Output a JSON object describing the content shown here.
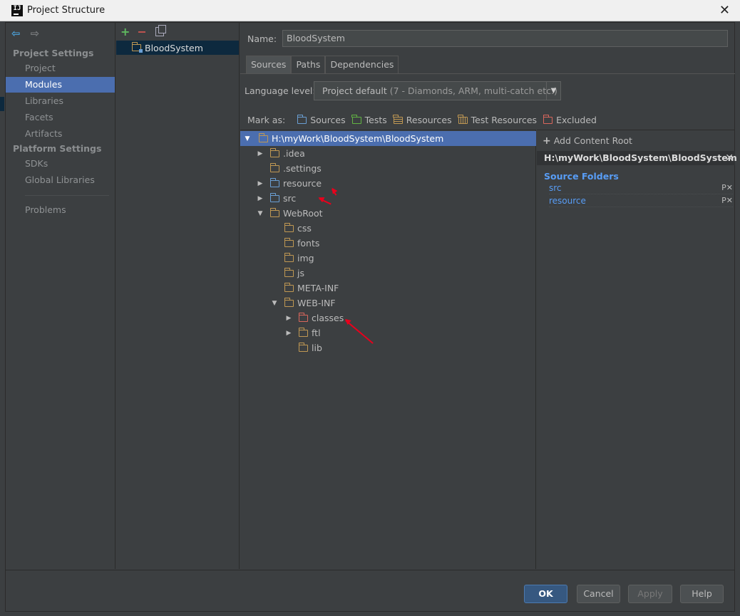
{
  "window": {
    "title": "Project Structure",
    "close_glyph": "✕",
    "app_icon": "IJ"
  },
  "nav": {
    "back_icon": "arrow-left-icon",
    "forward_icon": "arrow-right-icon",
    "project_settings": "Project Settings",
    "platform_settings": "Platform Settings",
    "items": {
      "project": "Project",
      "modules": "Modules",
      "libraries": "Libraries",
      "facets": "Facets",
      "artifacts": "Artifacts",
      "sdks": "SDKs",
      "global_libraries": "Global Libraries",
      "problems": "Problems"
    }
  },
  "modules": {
    "add": "+",
    "remove": "−",
    "selected": "BloodSystem"
  },
  "module": {
    "name_label": "Name:",
    "name_value": "BloodSystem",
    "tabs": [
      "Sources",
      "Paths",
      "Dependencies"
    ],
    "language_label": "Language level:",
    "language_value": "Project default",
    "language_detail": "(7 - Diamonds, ARM, multi-catch etc.)",
    "mark_as_label": "Mark as:",
    "mark_as": [
      "Sources",
      "Tests",
      "Resources",
      "Test Resources",
      "Excluded"
    ]
  },
  "tree": {
    "root": "H:\\myWork\\BloodSystem\\BloodSystem",
    "items": {
      "idea": ".idea",
      "settings": ".settings",
      "resource": "resource",
      "src": "src",
      "webroot": "WebRoot",
      "css": "css",
      "fonts": "fonts",
      "img": "img",
      "js": "js",
      "metainf": "META-INF",
      "webinf": "WEB-INF",
      "classes": "classes",
      "ftl": "ftl",
      "lib": "lib"
    }
  },
  "content_root": {
    "add_label": "Add Content Root",
    "path": "H:\\myWork\\BloodSystem\\BloodSystem",
    "source_folders_heading": "Source Folders",
    "source_folders": [
      "src",
      "resource"
    ],
    "row_actions": "P✕"
  },
  "footer": {
    "ok": "OK",
    "cancel": "Cancel",
    "apply": "Apply",
    "help": "Help"
  },
  "colors": {
    "selection": "#4b6eaf",
    "source_folder": "#6a9fd4",
    "excluded_folder": "#d9665c",
    "annotation_arrow": "#e8001c"
  }
}
